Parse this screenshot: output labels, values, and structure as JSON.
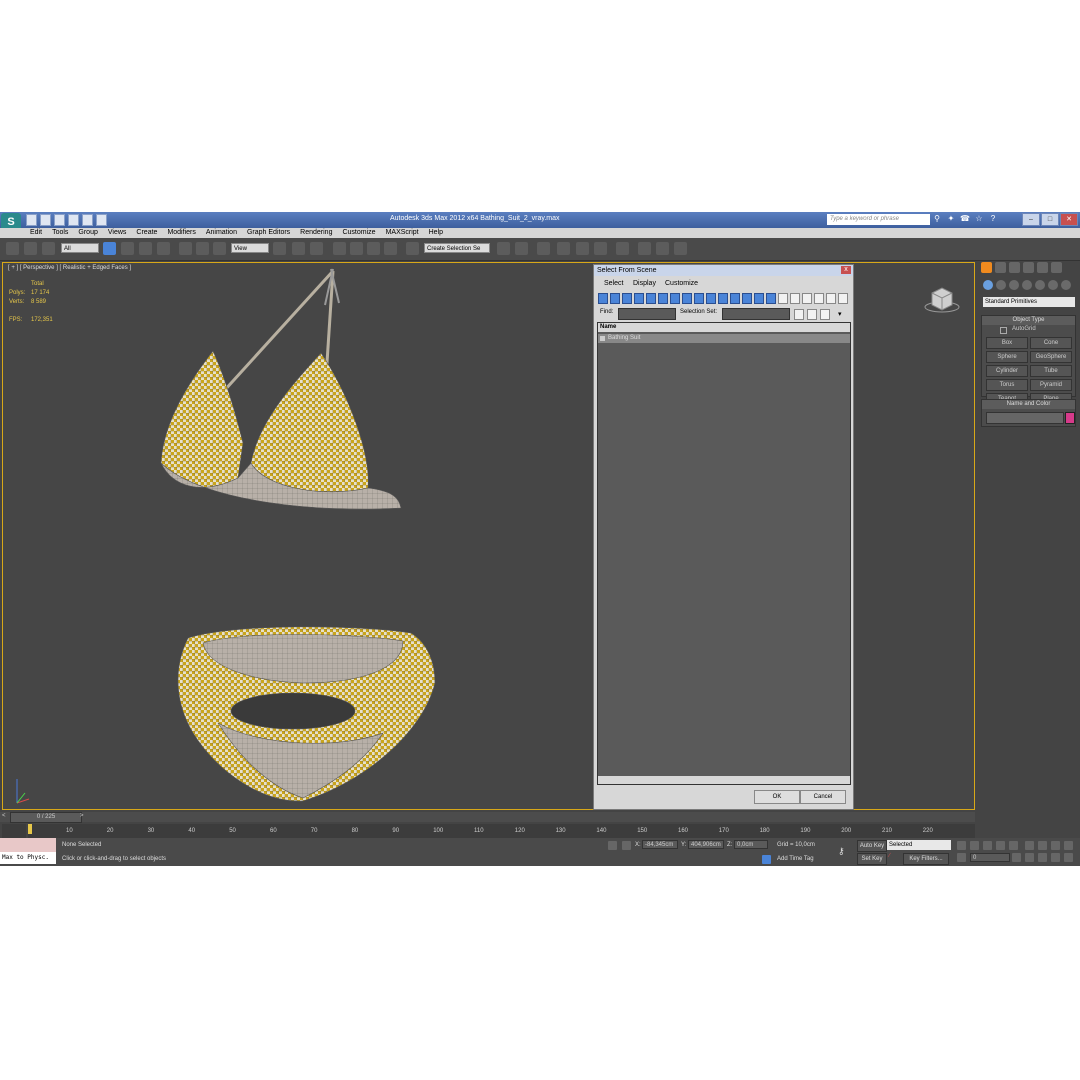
{
  "window": {
    "title": "Autodesk 3ds Max  2012 x64     Bathing_Suit_2_vray.max",
    "search_placeholder": "Type a keyword or phrase"
  },
  "menu": [
    "Edit",
    "Tools",
    "Group",
    "Views",
    "Create",
    "Modifiers",
    "Animation",
    "Graph Editors",
    "Rendering",
    "Customize",
    "MAXScript",
    "Help"
  ],
  "toolbar": {
    "filter_value": "All",
    "refcoord_value": "View",
    "selection_set_value": "Create Selection Se"
  },
  "viewport": {
    "label": "[ + ] [ Perspective ] [ Realistic + Edged Faces ]",
    "stats": {
      "total_label": "Total",
      "polys_label": "Polys:",
      "polys_value": "17 174",
      "verts_label": "Verts:",
      "verts_value": "8 589",
      "fps_label": "FPS:",
      "fps_value": "172,351"
    }
  },
  "dialog": {
    "title": "Select From Scene",
    "close_label": "x",
    "menu": [
      "Select",
      "Display",
      "Customize"
    ],
    "find_label": "Find:",
    "selection_set_label": "Selection Set:",
    "column_name": "Name",
    "items": [
      "Bathing Suit"
    ],
    "ok_label": "OK",
    "cancel_label": "Cancel"
  },
  "command_panel": {
    "category": "Standard Primitives",
    "object_type_title": "Object Type",
    "autogrid_label": "AutoGrid",
    "primitives": [
      "Box",
      "Cone",
      "Sphere",
      "GeoSphere",
      "Cylinder",
      "Tube",
      "Torus",
      "Pyramid",
      "Teapot",
      "Plane"
    ],
    "name_color_title": "Name and Color",
    "color": "#d63a8a"
  },
  "timeline": {
    "frame_label": "0 / 225",
    "ticks": [
      "10",
      "20",
      "30",
      "40",
      "50",
      "60",
      "70",
      "80",
      "90",
      "100",
      "110",
      "120",
      "130",
      "140",
      "150",
      "160",
      "170",
      "180",
      "190",
      "200",
      "210",
      "220"
    ]
  },
  "status": {
    "maxscript_text": "Max to Physc.",
    "selection_text": "None Selected",
    "prompt_text": "Click or click-and-drag to select objects",
    "x_label": "X:",
    "x_value": "-84,345cm",
    "y_label": "Y:",
    "y_value": "404,906cm",
    "z_label": "Z:",
    "z_value": "0,0cm",
    "grid_text": "Grid = 10,0cm",
    "add_time_tag": "Add Time Tag",
    "auto_key": "Auto Key",
    "set_key": "Set Key",
    "key_mode": "Selected",
    "key_filters": "Key Filters...",
    "current_frame": "0"
  }
}
